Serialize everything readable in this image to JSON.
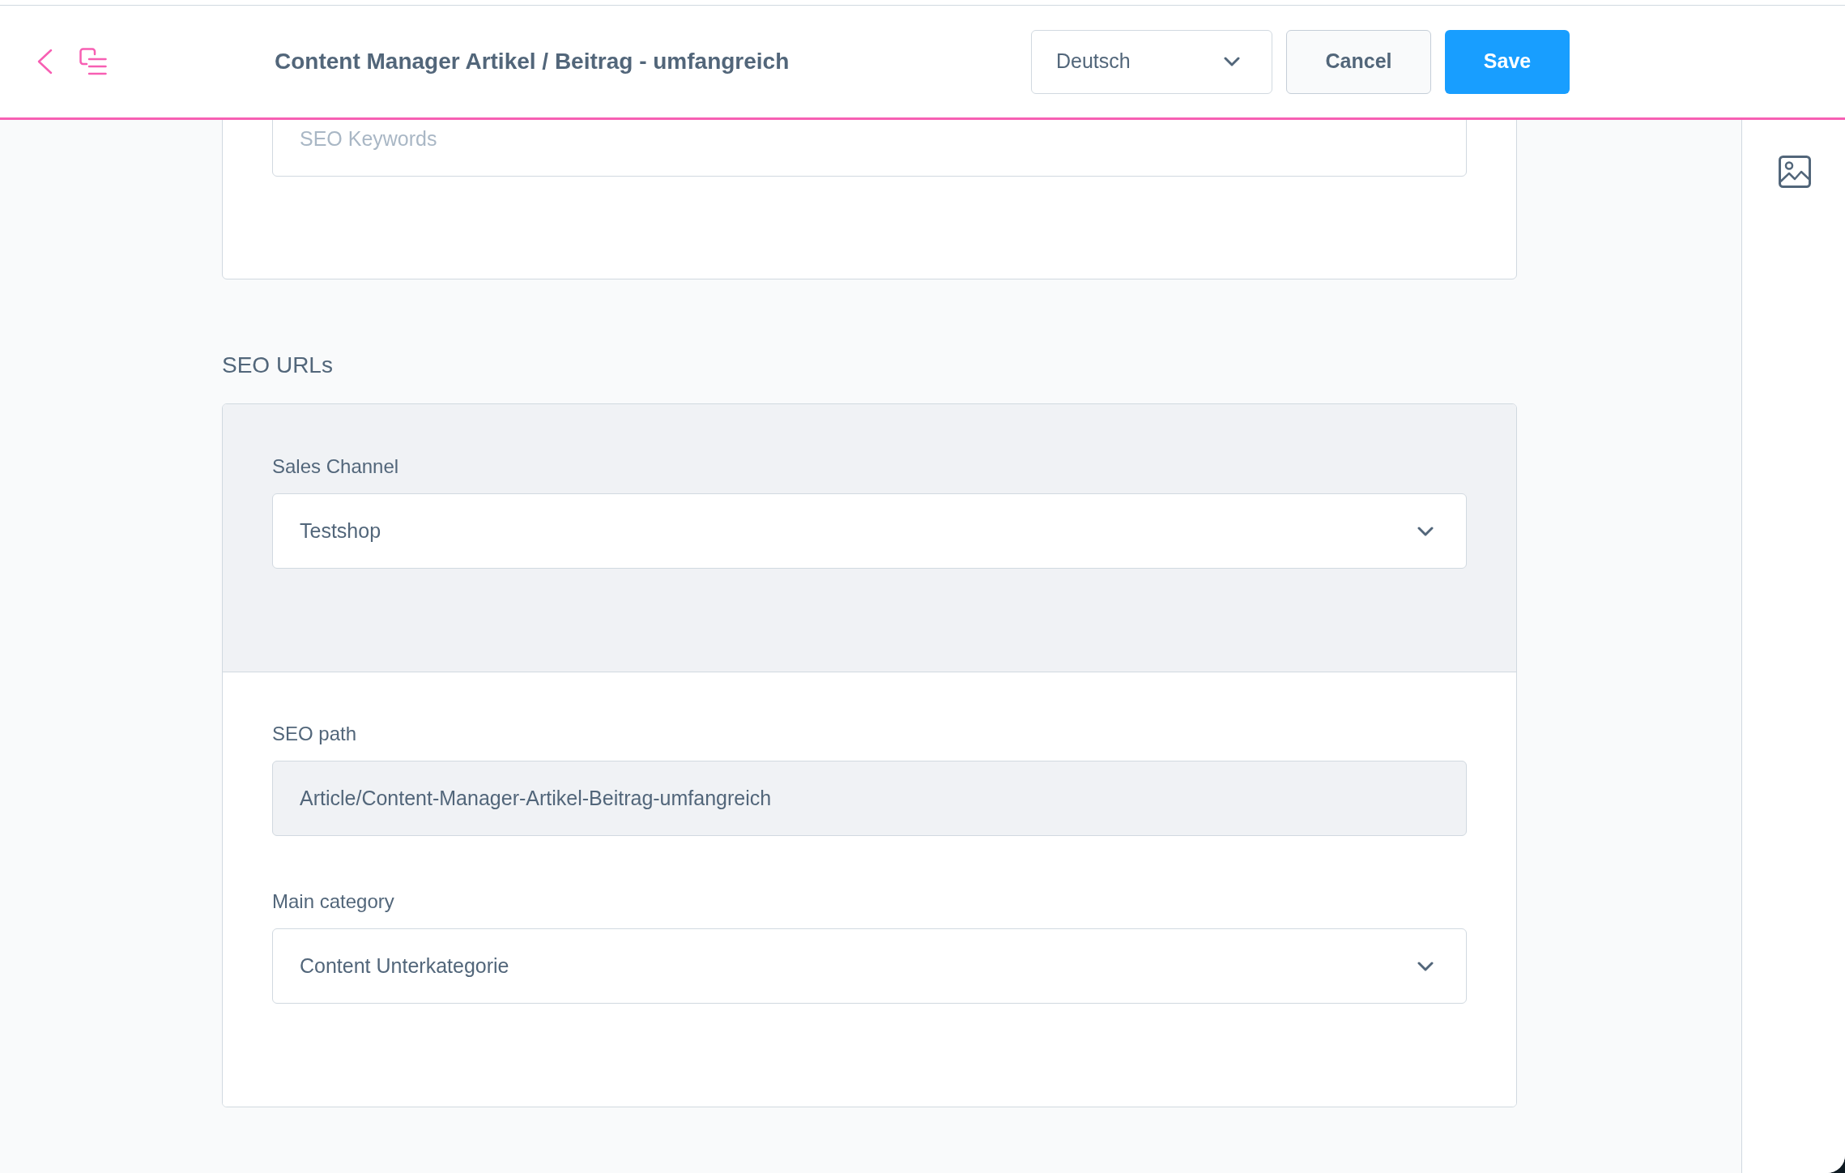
{
  "header": {
    "title": "Content Manager Artikel / Beitrag - umfangreich",
    "language_select": {
      "value": "Deutsch"
    },
    "buttons": [
      {
        "label": "Cancel",
        "kind": "secondary"
      },
      {
        "label": "Save",
        "kind": "primary"
      }
    ]
  },
  "seo_card": {
    "fields": [
      {
        "kind": "input",
        "placeholder": "SEO Keywords",
        "disabled": false
      }
    ]
  },
  "seo_urls": {
    "title": "SEO URLs",
    "sales_channel": {
      "kind": "select",
      "label": "Sales Channel",
      "value": "Testshop"
    },
    "fields": [
      {
        "kind": "input",
        "label": "SEO path",
        "value": "Article/Content-Manager-Artikel-Beitrag-umfangreich",
        "disabled": true
      },
      {
        "kind": "select",
        "label": "Main category",
        "value": "Content Unterkategorie",
        "disabled": false
      }
    ]
  }
}
